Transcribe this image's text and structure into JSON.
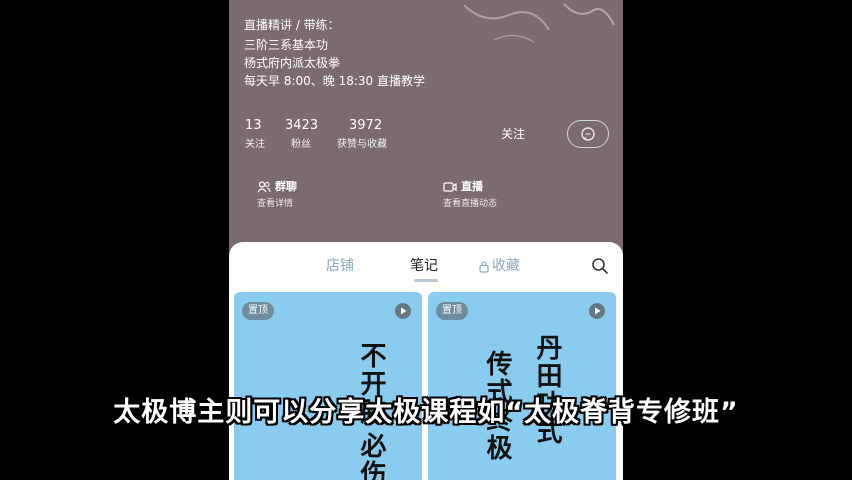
{
  "profile": {
    "bio_lines": [
      "直播精讲 / 带练：",
      "三阶三系基本功",
      "杨式府内派太极拳",
      "每天早 8:00、晚 18:30 直播教学"
    ]
  },
  "stats": [
    {
      "value": "13",
      "label": "关注"
    },
    {
      "value": "3423",
      "label": "粉丝"
    },
    {
      "value": "3972",
      "label": "获赞与收藏"
    }
  ],
  "actions": {
    "follow_label": "关注",
    "chat_icon": "chat-bubble-icon"
  },
  "features": [
    {
      "icon": "group-icon",
      "title": "群聊",
      "subtitle": "查看详情"
    },
    {
      "icon": "video-camera-icon",
      "title": "直播",
      "subtitle": "查看直播动态"
    }
  ],
  "tabs": [
    {
      "label": "店铺",
      "active": false
    },
    {
      "label": "笔记",
      "active": true
    },
    {
      "label": "收藏",
      "active": false,
      "icon": "lock-icon"
    }
  ],
  "search_icon": "search-icon",
  "cards": [
    {
      "badge": "置顶",
      "text_columns": [
        "必伤",
        "不开胯"
      ]
    },
    {
      "badge": "置顶",
      "text_columns": [
        "丹田功式",
        "传式终极"
      ]
    }
  ],
  "caption": "太极博主则可以分享太极课程如“太极脊背专修班”",
  "colors": {
    "banner_bg": "#7a6c6e",
    "card_bg": "#89ccef",
    "sheet_bg": "#ffffff",
    "tab_inactive": "#8aa9bf"
  }
}
